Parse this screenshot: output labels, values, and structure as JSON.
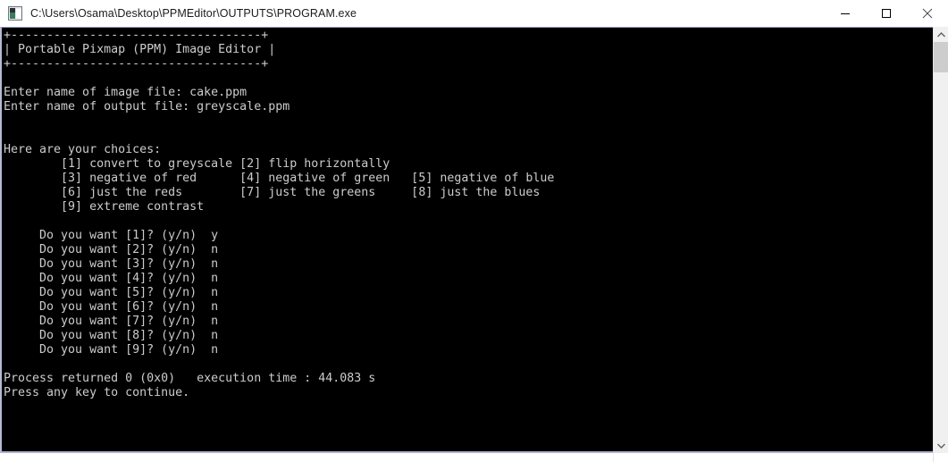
{
  "window": {
    "title": "C:\\Users\\Osama\\Desktop\\PPMEditor\\OUTPUTS\\PROGRAM.exe",
    "icon": "console-app-icon",
    "controls": {
      "minimize_label": "Minimize",
      "maximize_label": "Maximize",
      "close_label": "Close"
    },
    "colors": {
      "titlebar_bg": "#ffffff",
      "titlebar_fg": "#1b1b1b",
      "console_bg": "#000000",
      "console_fg": "#cccccc",
      "console_border": "#b8b8d8",
      "scrollbar_track": "#f0f0f0",
      "scrollbar_thumb": "#cdcdcd"
    }
  },
  "console": {
    "banner": {
      "top_rule": "+-----------------------------------+",
      "title_line": "| Portable Pixmap (PPM) Image Editor |",
      "bottom_rule": "+-----------------------------------+"
    },
    "prompts": [
      {
        "label": "Enter name of image file:",
        "value": "cake.ppm"
      },
      {
        "label": "Enter name of output file:",
        "value": "greyscale.ppm"
      }
    ],
    "menu": {
      "heading": "Here are your choices:",
      "options": [
        {
          "key": "[1]",
          "label": "convert to greyscale"
        },
        {
          "key": "[2]",
          "label": "flip horizontally"
        },
        {
          "key": "[3]",
          "label": "negative of red"
        },
        {
          "key": "[4]",
          "label": "negative of green"
        },
        {
          "key": "[5]",
          "label": "negative of blue"
        },
        {
          "key": "[6]",
          "label": "just the reds"
        },
        {
          "key": "[7]",
          "label": "just the greens"
        },
        {
          "key": "[8]",
          "label": "just the blues"
        },
        {
          "key": "[9]",
          "label": "extreme contrast"
        }
      ]
    },
    "questions": [
      {
        "text": "Do you want [1]? (y/n)",
        "answer": "y"
      },
      {
        "text": "Do you want [2]? (y/n)",
        "answer": "n"
      },
      {
        "text": "Do you want [3]? (y/n)",
        "answer": "n"
      },
      {
        "text": "Do you want [4]? (y/n)",
        "answer": "n"
      },
      {
        "text": "Do you want [5]? (y/n)",
        "answer": "n"
      },
      {
        "text": "Do you want [6]? (y/n)",
        "answer": "n"
      },
      {
        "text": "Do you want [7]? (y/n)",
        "answer": "n"
      },
      {
        "text": "Do you want [8]? (y/n)",
        "answer": "n"
      },
      {
        "text": "Do you want [9]? (y/n)",
        "answer": "n"
      }
    ],
    "footer": {
      "process_line": "Process returned 0 (0x0)   execution time : 44.083 s",
      "press_any_key": "Press any key to continue.",
      "return_code": "0",
      "return_code_hex": "0x0",
      "execution_time": "44.083 s"
    },
    "full_text": "+-----------------------------------+\n| Portable Pixmap (PPM) Image Editor |\n+-----------------------------------+\n\nEnter name of image file: cake.ppm\nEnter name of output file: greyscale.ppm\n\n\nHere are your choices:\n        [1] convert to greyscale [2] flip horizontally\n        [3] negative of red      [4] negative of green   [5] negative of blue\n        [6] just the reds        [7] just the greens     [8] just the blues\n        [9] extreme contrast\n\n     Do you want [1]? (y/n)  y\n     Do you want [2]? (y/n)  n\n     Do you want [3]? (y/n)  n\n     Do you want [4]? (y/n)  n\n     Do you want [5]? (y/n)  n\n     Do you want [6]? (y/n)  n\n     Do you want [7]? (y/n)  n\n     Do you want [8]? (y/n)  n\n     Do you want [9]? (y/n)  n\n\nProcess returned 0 (0x0)   execution time : 44.083 s\nPress any key to continue."
  },
  "scrollbar": {
    "up_arrow": "scroll-up-icon",
    "down_arrow": "scroll-down-icon",
    "thumb": "scroll-thumb"
  }
}
